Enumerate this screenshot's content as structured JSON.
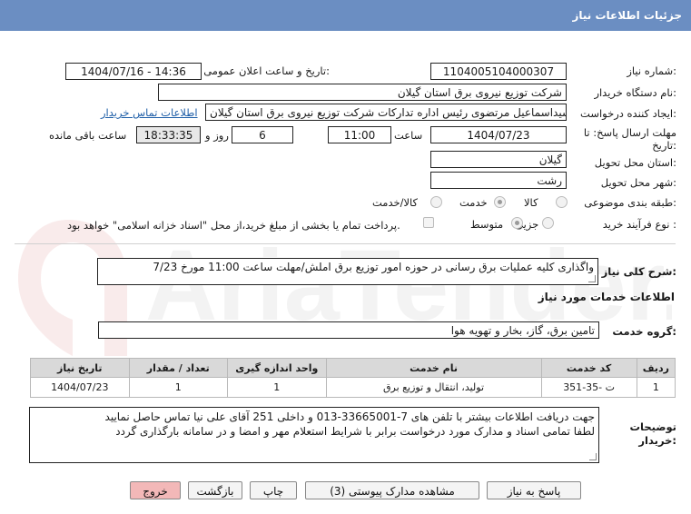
{
  "header": {
    "title": "جزئیات اطلاعات نیاز"
  },
  "watermark": {
    "text": "AriaTender.net"
  },
  "fields": {
    "need_number_label": "شماره نیاز:",
    "need_number": "1104005104000307",
    "announce_label": "تاریخ و ساعت اعلان عمومی:",
    "announce_value": "1404/07/16 - 14:36",
    "buyer_org_label": "نام دستگاه خریدار:",
    "buyer_org": "شرکت توزیع نیروی برق استان گیلان",
    "creator_label": "ایجاد کننده درخواست:",
    "creator": "سیداسماعیل مرتضوی رئیس اداره تدارکات شرکت توزیع نیروی برق استان گیلان",
    "contact_link": "اطلاعات تماس خریدار",
    "deadline_label_1": "مهلت ارسال پاسخ: تا",
    "deadline_label_2": "تاریخ:",
    "deadline_date": "1404/07/23",
    "time_label": "ساعت",
    "deadline_time": "11:00",
    "days_value": "6",
    "days_label": "روز و",
    "remaining_time": "18:33:35",
    "remaining_label": "ساعت باقی مانده",
    "province_label": "استان محل تحویل:",
    "province": "گیلان",
    "city_label": "شهر محل تحویل:",
    "city": "رشت",
    "category_label": "طبقه بندی موضوعی:",
    "category_options": [
      "کالا",
      "خدمت",
      "کالا/خدمت"
    ],
    "category_selected": "خدمت",
    "process_label": "نوع فرآیند خرید :",
    "process_options": [
      "جزیی",
      "متوسط"
    ],
    "process_selected": "متوسط",
    "payment_note": "پرداخت تمام یا بخشی از مبلغ خرید،از محل \"اسناد خزانه اسلامی\" خواهد بود."
  },
  "summary": {
    "label": "شرح کلی نیاز:",
    "value": "واگذاری کلیه عملیات برق رسانی در حوزه امور توزیع برق املش/مهلت ساعت 11:00 مورخ 7/23"
  },
  "services_section": {
    "title": "اطلاعات خدمات مورد نیاز",
    "group_label": "گروه خدمت:",
    "group_value": "تامین برق، گاز، بخار و تهویه هوا"
  },
  "table": {
    "headers": [
      "ردیف",
      "کد خدمت",
      "نام خدمت",
      "واحد اندازه گیری",
      "تعداد / مقدار",
      "تاریخ نیاز"
    ],
    "rows": [
      [
        "1",
        "ت -35-351",
        "تولید، انتقال و توزیع برق",
        "1",
        "1",
        "1404/07/23"
      ]
    ]
  },
  "buyer_notes": {
    "label_1": "توضیحات",
    "label_2": "خریدار:",
    "line_1": "جهت دریافت اطلاعات بیشتر با تلفن های 7-33665001-013 و داخلی 251 آقای علی نیا تماس حاصل نمایید",
    "line_2": "لطفا تمامی اسناد و مدارک مورد درخواست برابر با شرایط استعلام مهر و امضا و در سامانه بارگذاری گردد"
  },
  "buttons": {
    "reply": "پاسخ به نیاز",
    "attachments": "مشاهده مدارک پیوستی (3)",
    "print": "چاپ",
    "back": "بازگشت",
    "exit": "خروج"
  }
}
